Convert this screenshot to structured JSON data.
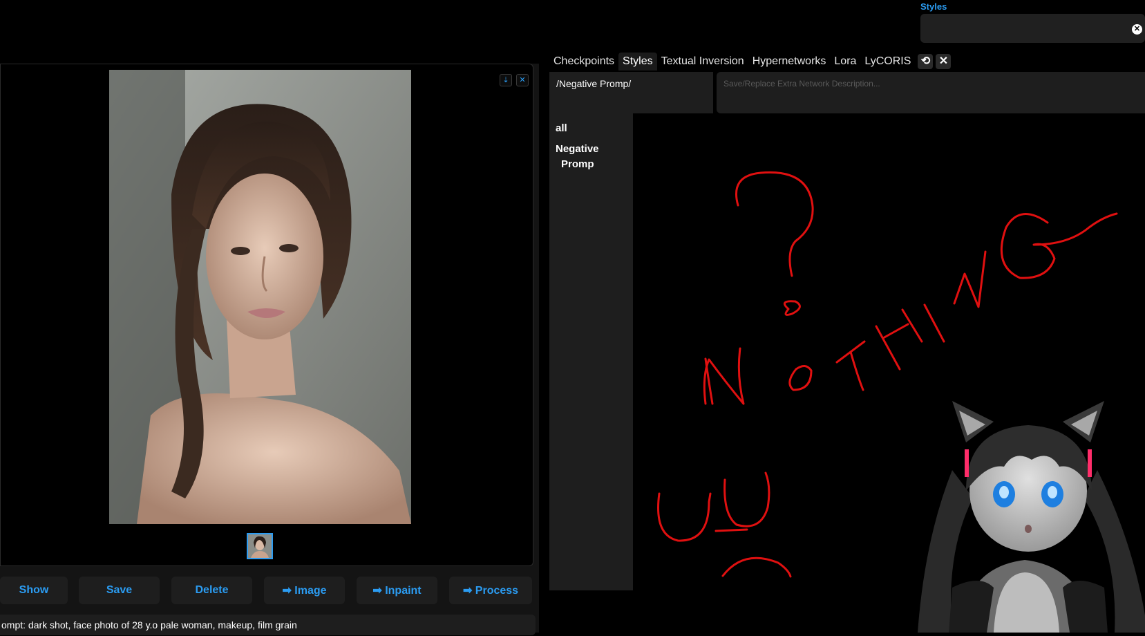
{
  "styles": {
    "label": "Styles",
    "clear_icon": "close-icon"
  },
  "gallery": {
    "download_icon": "download-icon",
    "close_icon": "close-icon",
    "buttons": [
      "Show",
      "Save",
      "Delete",
      "➡ Image",
      "➡ Inpaint",
      "➡ Process"
    ],
    "prompt_text": "ompt: dark shot, face photo of 28 y.o pale woman, makeup, film grain"
  },
  "extra_networks": {
    "tabs": [
      "Checkpoints",
      "Styles",
      "Textual Inversion",
      "Hypernetworks",
      "Lora",
      "LyCORIS"
    ],
    "active_tab": "Styles",
    "refresh_icon": "refresh-icon",
    "close_icon": "close-icon",
    "path": "/Negative Promp/",
    "description_placeholder": "Save/Replace Extra Network Description...",
    "tree": [
      "all",
      "Negative",
      "Promp"
    ]
  },
  "colors": {
    "accent": "#2b9cf2",
    "drawing": "#e01010",
    "panel": "#1e1e1e"
  }
}
